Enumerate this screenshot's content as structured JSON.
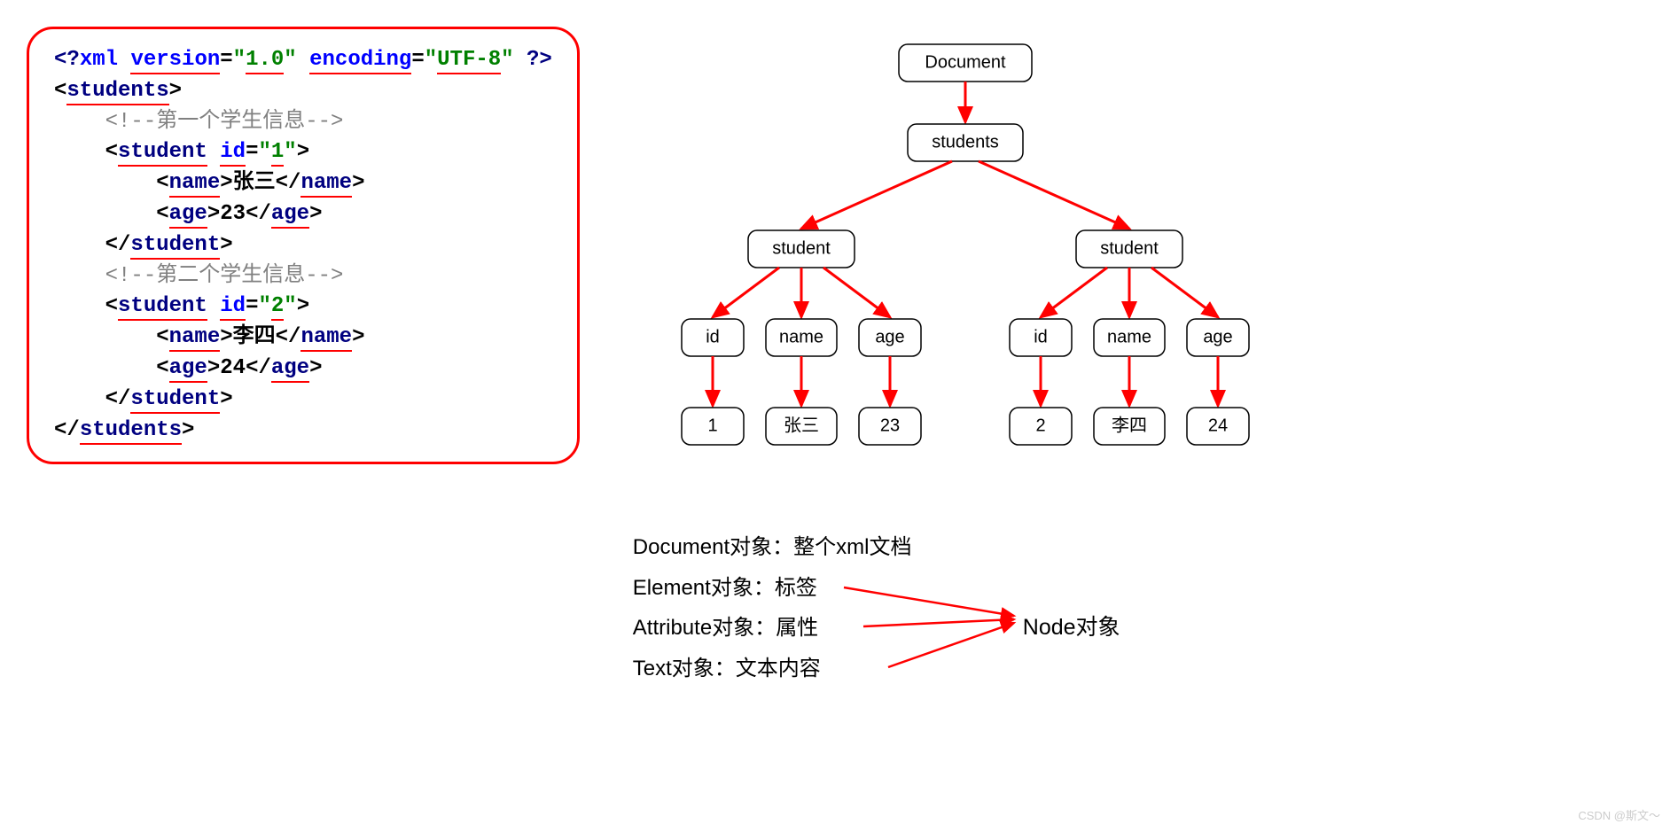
{
  "code": {
    "decl_open": "<?",
    "decl_xml": "xml",
    "decl_ver_attr": "version",
    "decl_ver_val": "1.0",
    "decl_enc_attr": "encoding",
    "decl_enc_val": "UTF-8",
    "decl_close": "?>",
    "root_open": "students",
    "comment1": "<!--第一个学生信息-->",
    "student_tag": "student",
    "id_attr": "id",
    "id1": "1",
    "name_tag": "name",
    "name1_val": "张三",
    "age_tag": "age",
    "age1_val": "23",
    "comment2": "<!--第二个学生信息-->",
    "id2": "2",
    "name2_val": "李四",
    "age2_val": "24",
    "root_close": "students"
  },
  "tree": {
    "level0": "Document",
    "level1": "students",
    "level2": [
      "student",
      "student"
    ],
    "level3": [
      "id",
      "name",
      "age",
      "id",
      "name",
      "age"
    ],
    "level4": [
      "1",
      "张三",
      "23",
      "2",
      "李四",
      "24"
    ]
  },
  "legend": {
    "row1_label": "Document对象：",
    "row1_val": "整个xml文档",
    "row2_label": "Element对象：",
    "row2_val": "标签",
    "row3_label": "Attribute对象：",
    "row3_val": "属性",
    "row4_label": "Text对象：",
    "row4_val": "文本内容",
    "node_label": "Node对象"
  },
  "watermark": "CSDN @斯文～"
}
